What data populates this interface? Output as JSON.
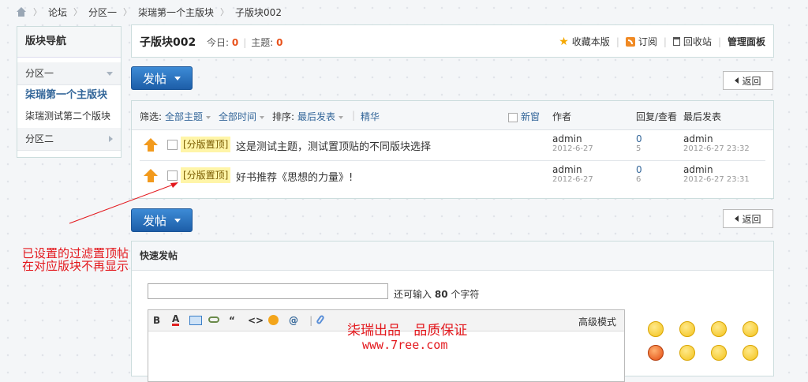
{
  "breadcrumb": [
    "论坛",
    "分区一",
    "柒瑞第一个主版块",
    "子版块002"
  ],
  "sidebar": {
    "title": "版块导航",
    "groups": [
      {
        "label": "分区一",
        "items": [
          "柒瑞第一个主版块",
          "柒瑞测试第二个版块"
        ]
      },
      {
        "label": "分区二"
      }
    ]
  },
  "forum": {
    "name": "子版块002",
    "today_label": "今日:",
    "today_count": "0",
    "threads_label": "主题:",
    "threads_count": "0",
    "actions": {
      "favorite": "收藏本版",
      "subscribe": "订阅",
      "recycle": "回收站",
      "admin": "管理面板"
    }
  },
  "buttons": {
    "post": "发帖",
    "back": "返回"
  },
  "filters": {
    "label": "筛选:",
    "all_topics": "全部主题",
    "all_time": "全部时间",
    "sort_label": "排序:",
    "sort_value": "最后发表",
    "digest": "精华",
    "new_window": "新窗",
    "col_author": "作者",
    "col_replies": "回复/查看",
    "col_last": "最后发表"
  },
  "threads": [
    {
      "tag": "[分版置顶]",
      "subject": "这是测试主题，测试置顶贴的不同版块选择",
      "author": "admin",
      "date": "2012-6-27",
      "replies": "0",
      "views": "5",
      "last_author": "admin",
      "last_date": "2012-6-27 23:32"
    },
    {
      "tag": "[分版置顶]",
      "subject": "好书推荐《思想的力量》!",
      "author": "admin",
      "date": "2012-6-27",
      "replies": "0",
      "views": "6",
      "last_author": "admin",
      "last_date": "2012-6-27 23:31"
    }
  ],
  "quick_post": {
    "title": "快速发帖",
    "remaining_prefix": "还可输入",
    "remaining_count": "80",
    "remaining_suffix": "个字符",
    "advanced_mode": "高级模式",
    "toolbar": {
      "bold": "B",
      "font_color": "A",
      "quote": "“",
      "code": "<>",
      "at": "@"
    }
  },
  "annotation": {
    "line1": "已设置的过滤置顶帖",
    "line2": "在对应版块不再显示"
  },
  "watermark": {
    "line1": "柒瑞出品   品质保证",
    "line2": "www.7ree.com"
  },
  "colors": {
    "accent": "#336699",
    "count": "#e8511a",
    "annotation": "#e3171c",
    "tag_bg": "#fff5a8",
    "button": "#1d5ea8"
  }
}
